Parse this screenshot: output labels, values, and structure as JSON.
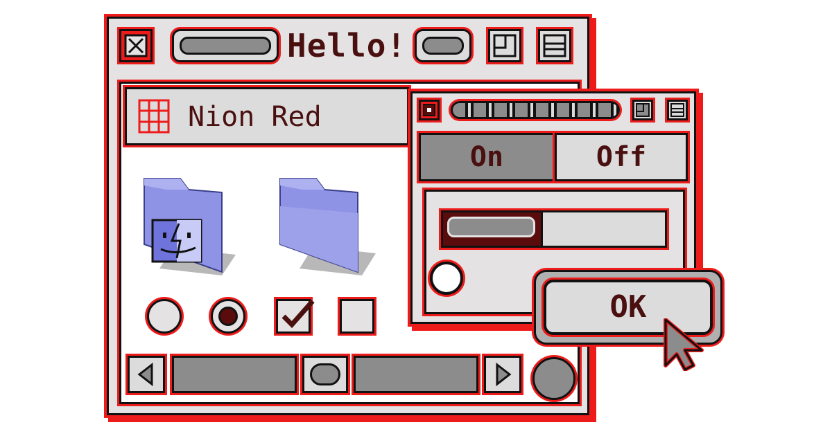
{
  "main_window": {
    "title": "Hello!",
    "path_label": "Nion Red",
    "icons": [
      "close-box-icon",
      "zoom-box-icon",
      "collapse-box-icon",
      "mac-os-folder-icon",
      "folder-icon",
      "grid-icon"
    ]
  },
  "controls": {
    "radio_unselected": false,
    "radio_selected": true,
    "checkbox_checked": true,
    "checkbox_unchecked": false
  },
  "scrollbar": {
    "left_arrow": "◀",
    "right_arrow": "▶"
  },
  "dialog": {
    "tab_on": "On",
    "tab_off": "Off",
    "ok_label": "OK",
    "progress": 0.45
  },
  "colors": {
    "accent": "#ee1b1b",
    "dark": "#111111",
    "panel": "#e4e2e2",
    "gray": "#8c8c8c",
    "text": "#4a1010",
    "folder": "#8f93e6"
  }
}
